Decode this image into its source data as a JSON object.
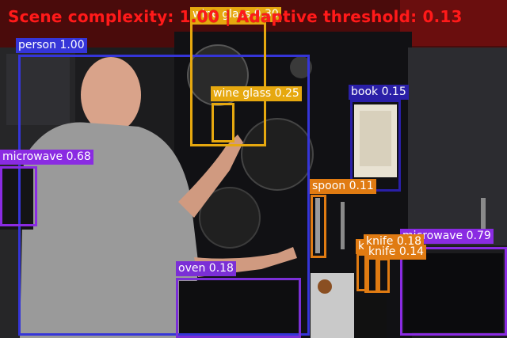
{
  "header": {
    "text": "Scene complexity: 1.00 | Adaptive threshold: 0.13"
  },
  "colors": {
    "person": "#3535d8",
    "wine_glass": "#e6a80f",
    "microwave": "#8a2be2",
    "book": "#2a1fa8",
    "spoon": "#e07b12",
    "oven": "#7b2fd6",
    "knife": "#e07b12",
    "header": "#ff1a1a"
  },
  "detections": [
    {
      "id": "wine-glass-top",
      "label": "wine glass 0.30",
      "class": "wine_glass",
      "score": 0.3
    },
    {
      "id": "person",
      "label": "person 1.00",
      "class": "person",
      "score": 1.0
    },
    {
      "id": "wine-glass",
      "label": "wine glass 0.25",
      "class": "wine_glass",
      "score": 0.25
    },
    {
      "id": "book",
      "label": "book 0.15",
      "class": "book",
      "score": 0.15
    },
    {
      "id": "microwave-left",
      "label": "microwave 0.68",
      "class": "microwave",
      "score": 0.68
    },
    {
      "id": "spoon",
      "label": "spoon 0.11",
      "class": "spoon",
      "score": 0.11
    },
    {
      "id": "microwave-right",
      "label": "microwave 0.79",
      "class": "microwave",
      "score": 0.79
    },
    {
      "id": "knife-a",
      "label": "knife 0.18",
      "class": "knife",
      "score": 0.18
    },
    {
      "id": "knife-b",
      "label": "knife 0.14",
      "class": "knife",
      "score": 0.14
    },
    {
      "id": "knife-c",
      "label": "k",
      "class": "knife",
      "score": null
    },
    {
      "id": "oven",
      "label": "oven 0.18",
      "class": "oven",
      "score": 0.18
    }
  ]
}
